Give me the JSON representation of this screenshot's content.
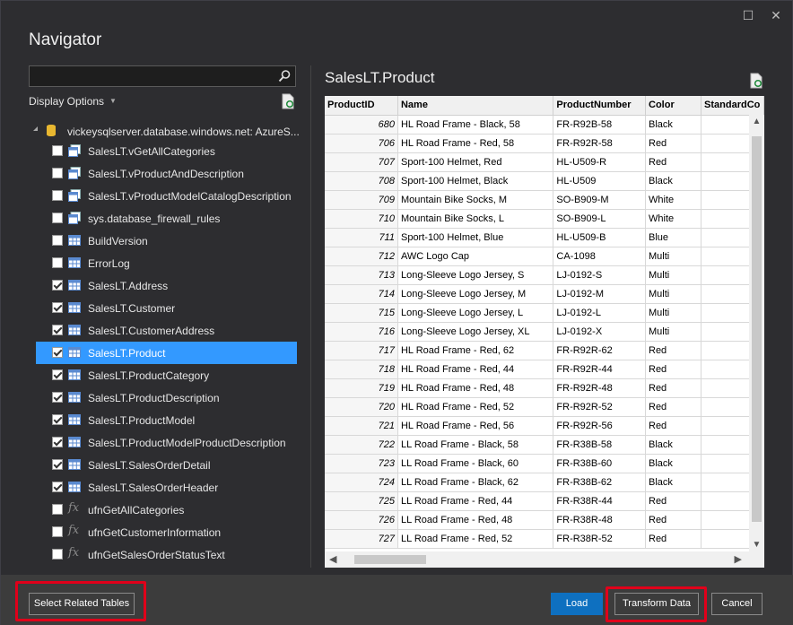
{
  "window": {
    "title": "Navigator"
  },
  "search": {
    "value": "",
    "placeholder": ""
  },
  "left": {
    "display_options_label": "Display Options",
    "server_label": "vickeysqlserver.database.windows.net: AzureS...",
    "items": [
      {
        "label": "SalesLT.vGetAllCategories",
        "type": "view",
        "checked": false,
        "selected": false
      },
      {
        "label": "SalesLT.vProductAndDescription",
        "type": "view",
        "checked": false,
        "selected": false
      },
      {
        "label": "SalesLT.vProductModelCatalogDescription",
        "type": "view",
        "checked": false,
        "selected": false
      },
      {
        "label": "sys.database_firewall_rules",
        "type": "view",
        "checked": false,
        "selected": false
      },
      {
        "label": "BuildVersion",
        "type": "table",
        "checked": false,
        "selected": false
      },
      {
        "label": "ErrorLog",
        "type": "table",
        "checked": false,
        "selected": false
      },
      {
        "label": "SalesLT.Address",
        "type": "table",
        "checked": true,
        "selected": false
      },
      {
        "label": "SalesLT.Customer",
        "type": "table",
        "checked": true,
        "selected": false
      },
      {
        "label": "SalesLT.CustomerAddress",
        "type": "table",
        "checked": true,
        "selected": false
      },
      {
        "label": "SalesLT.Product",
        "type": "table",
        "checked": true,
        "selected": true
      },
      {
        "label": "SalesLT.ProductCategory",
        "type": "table",
        "checked": true,
        "selected": false
      },
      {
        "label": "SalesLT.ProductDescription",
        "type": "table",
        "checked": true,
        "selected": false
      },
      {
        "label": "SalesLT.ProductModel",
        "type": "table",
        "checked": true,
        "selected": false
      },
      {
        "label": "SalesLT.ProductModelProductDescription",
        "type": "table",
        "checked": true,
        "selected": false
      },
      {
        "label": "SalesLT.SalesOrderDetail",
        "type": "table",
        "checked": true,
        "selected": false
      },
      {
        "label": "SalesLT.SalesOrderHeader",
        "type": "table",
        "checked": true,
        "selected": false
      },
      {
        "label": "ufnGetAllCategories",
        "type": "function",
        "checked": false,
        "selected": false
      },
      {
        "label": "ufnGetCustomerInformation",
        "type": "function",
        "checked": false,
        "selected": false
      },
      {
        "label": "ufnGetSalesOrderStatusText",
        "type": "function",
        "checked": false,
        "selected": false
      }
    ]
  },
  "preview": {
    "title": "SalesLT.Product",
    "columns": [
      "ProductID",
      "Name",
      "ProductNumber",
      "Color",
      "StandardCo"
    ],
    "rows": [
      [
        "680",
        "HL Road Frame - Black, 58",
        "FR-R92B-58",
        "Black",
        ""
      ],
      [
        "706",
        "HL Road Frame - Red, 58",
        "FR-R92R-58",
        "Red",
        ""
      ],
      [
        "707",
        "Sport-100 Helmet, Red",
        "HL-U509-R",
        "Red",
        ""
      ],
      [
        "708",
        "Sport-100 Helmet, Black",
        "HL-U509",
        "Black",
        ""
      ],
      [
        "709",
        "Mountain Bike Socks, M",
        "SO-B909-M",
        "White",
        ""
      ],
      [
        "710",
        "Mountain Bike Socks, L",
        "SO-B909-L",
        "White",
        ""
      ],
      [
        "711",
        "Sport-100 Helmet, Blue",
        "HL-U509-B",
        "Blue",
        ""
      ],
      [
        "712",
        "AWC Logo Cap",
        "CA-1098",
        "Multi",
        ""
      ],
      [
        "713",
        "Long-Sleeve Logo Jersey, S",
        "LJ-0192-S",
        "Multi",
        ""
      ],
      [
        "714",
        "Long-Sleeve Logo Jersey, M",
        "LJ-0192-M",
        "Multi",
        ""
      ],
      [
        "715",
        "Long-Sleeve Logo Jersey, L",
        "LJ-0192-L",
        "Multi",
        ""
      ],
      [
        "716",
        "Long-Sleeve Logo Jersey, XL",
        "LJ-0192-X",
        "Multi",
        ""
      ],
      [
        "717",
        "HL Road Frame - Red, 62",
        "FR-R92R-62",
        "Red",
        ""
      ],
      [
        "718",
        "HL Road Frame - Red, 44",
        "FR-R92R-44",
        "Red",
        ""
      ],
      [
        "719",
        "HL Road Frame - Red, 48",
        "FR-R92R-48",
        "Red",
        ""
      ],
      [
        "720",
        "HL Road Frame - Red, 52",
        "FR-R92R-52",
        "Red",
        ""
      ],
      [
        "721",
        "HL Road Frame - Red, 56",
        "FR-R92R-56",
        "Red",
        ""
      ],
      [
        "722",
        "LL Road Frame - Black, 58",
        "FR-R38B-58",
        "Black",
        ""
      ],
      [
        "723",
        "LL Road Frame - Black, 60",
        "FR-R38B-60",
        "Black",
        ""
      ],
      [
        "724",
        "LL Road Frame - Black, 62",
        "FR-R38B-62",
        "Black",
        ""
      ],
      [
        "725",
        "LL Road Frame - Red, 44",
        "FR-R38R-44",
        "Red",
        ""
      ],
      [
        "726",
        "LL Road Frame - Red, 48",
        "FR-R38R-48",
        "Red",
        ""
      ],
      [
        "727",
        "LL Road Frame - Red, 52",
        "FR-R38R-52",
        "Red",
        ""
      ]
    ]
  },
  "buttons": {
    "select_related": "Select Related Tables",
    "load": "Load",
    "transform": "Transform Data",
    "cancel": "Cancel"
  },
  "colors": {
    "accent": "#3399ff",
    "primary_button": "#0e70c0",
    "highlight_box": "#e0001a",
    "background": "#2d2d30"
  }
}
